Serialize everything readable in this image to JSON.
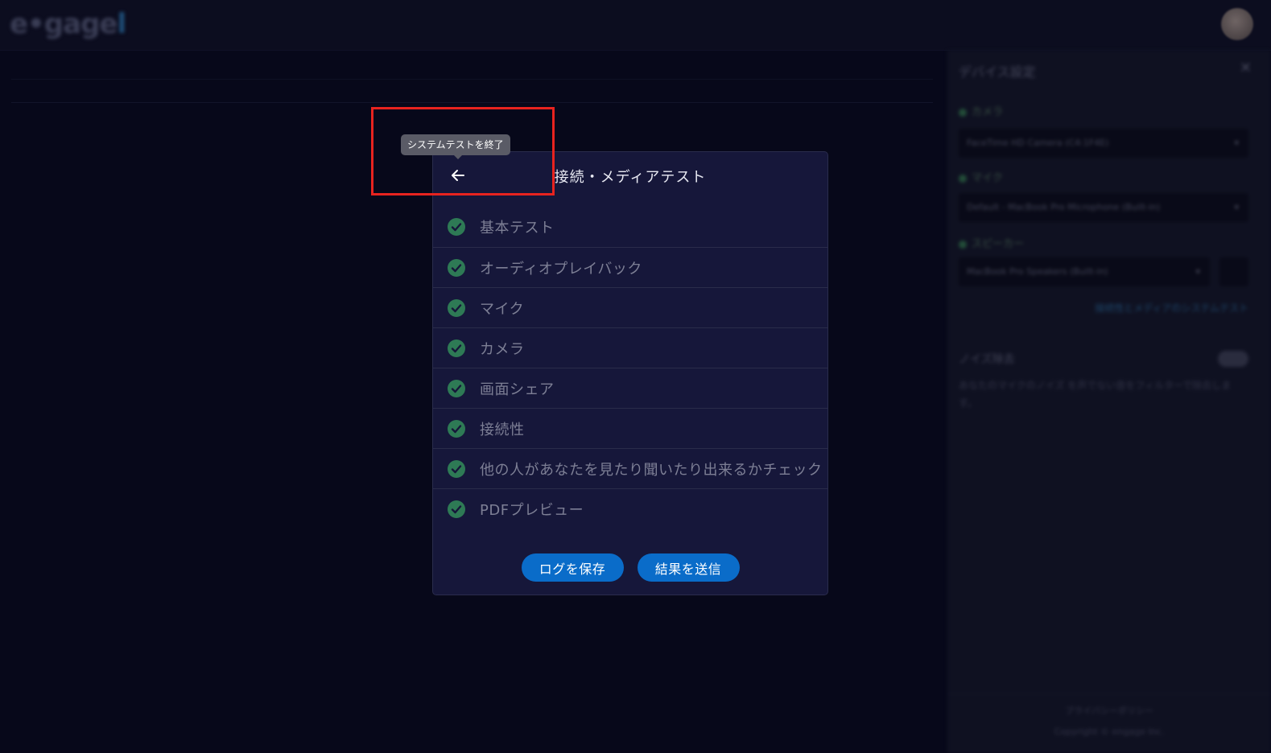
{
  "app": {
    "logo_text": "e•gage",
    "logo_dot": "l"
  },
  "side_panel": {
    "title": "デバイス設定",
    "close_icon": "close-icon",
    "camera_label": "カメラ",
    "camera_value": "FaceTime HD Camera (C4:1F4E)",
    "mic_label": "マイク",
    "mic_value": "Default - MacBook Pro Microphone (Built-in)",
    "speaker_label": "スピーカー",
    "speaker_value": "MacBook Pro Speakers (Built-in)",
    "system_test_link": "接続性とメディアのシステムテスト",
    "noise_label": "ノイズ除去",
    "noise_desc": "あなたのマイクのノイズ を声でない音をフィルターで除去します。",
    "footer_line1": "プライバシーポリシー",
    "footer_line2": "Copyright © engage Inc."
  },
  "modal": {
    "title": "接続・メディアテスト",
    "back_icon": "arrow-left-icon",
    "tests": [
      {
        "label": "基本テスト",
        "status": "passed"
      },
      {
        "label": "オーディオプレイバック",
        "status": "passed"
      },
      {
        "label": "マイク",
        "status": "passed"
      },
      {
        "label": "カメラ",
        "status": "passed"
      },
      {
        "label": "画面シェア",
        "status": "passed"
      },
      {
        "label": "接続性",
        "status": "passed"
      },
      {
        "label": "他の人があなたを見たり聞いたり出来るかチェック",
        "status": "passed"
      },
      {
        "label": "PDFプレビュー",
        "status": "passed"
      }
    ],
    "save_log_label": "ログを保存",
    "send_results_label": "結果を送信"
  },
  "tooltip": {
    "text": "システムテストを終了"
  },
  "colors": {
    "accent": "#0a6cc9",
    "check": "#2e7a55",
    "highlight": "#e8231f",
    "modal_bg": "#16173a"
  }
}
